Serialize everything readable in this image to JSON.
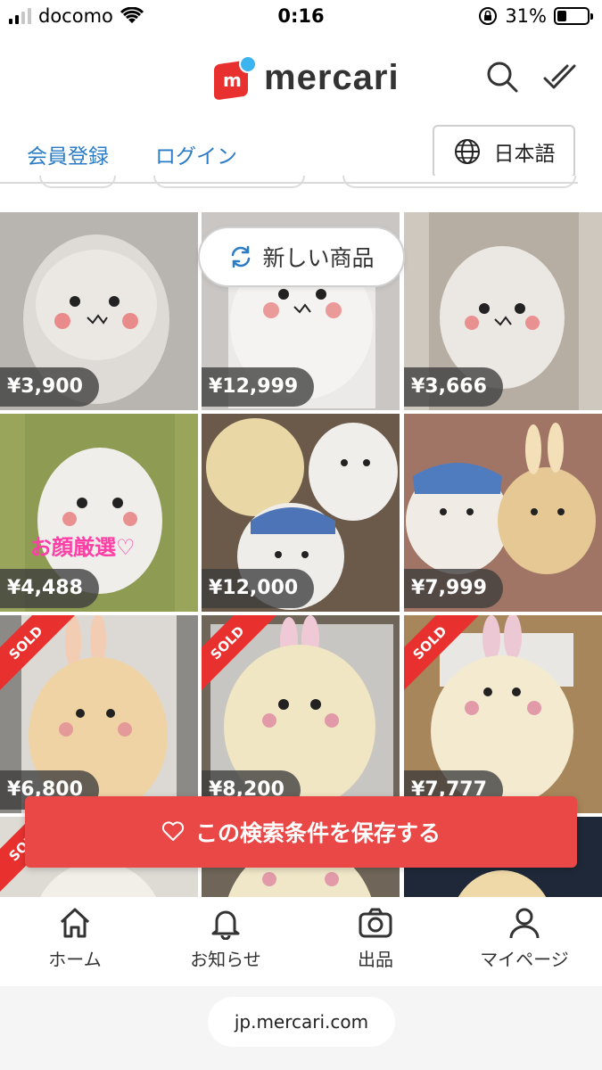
{
  "status_bar": {
    "carrier": "docomo",
    "time": "0:16",
    "battery": "31%"
  },
  "header": {
    "logo_text": "mercari",
    "accent_red": "#e8312f",
    "accent_blue": "#3cb4f0"
  },
  "auth": {
    "register": "会員登録",
    "login": "ログイン",
    "language": "日本語"
  },
  "new_items_pill": "新しい商品",
  "items": [
    {
      "price": "¥3,900",
      "sold": false,
      "overlay": ""
    },
    {
      "price": "¥12,999",
      "sold": false,
      "overlay": ""
    },
    {
      "price": "¥3,666",
      "sold": false,
      "overlay": ""
    },
    {
      "price": "¥4,488",
      "sold": false,
      "overlay": "お顔厳選♡"
    },
    {
      "price": "¥12,000",
      "sold": false,
      "overlay": ""
    },
    {
      "price": "¥7,999",
      "sold": false,
      "overlay": ""
    },
    {
      "price": "¥6,800",
      "sold": true,
      "sold_label": "SOLD",
      "overlay": ""
    },
    {
      "price": "¥8,200",
      "sold": true,
      "sold_label": "SOLD",
      "overlay": ""
    },
    {
      "price": "¥7,777",
      "sold": true,
      "sold_label": "SOLD",
      "overlay": ""
    },
    {
      "price": "",
      "sold": true,
      "sold_label": "SOLD",
      "overlay": ""
    },
    {
      "price": "",
      "sold": false,
      "overlay": ""
    },
    {
      "price": "",
      "sold": false,
      "overlay": ""
    }
  ],
  "save_search": "この検索条件を保存する",
  "bottom_nav": {
    "home": "ホーム",
    "notifications": "お知らせ",
    "sell": "出品",
    "mypage": "マイページ"
  },
  "url": "jp.mercari.com"
}
